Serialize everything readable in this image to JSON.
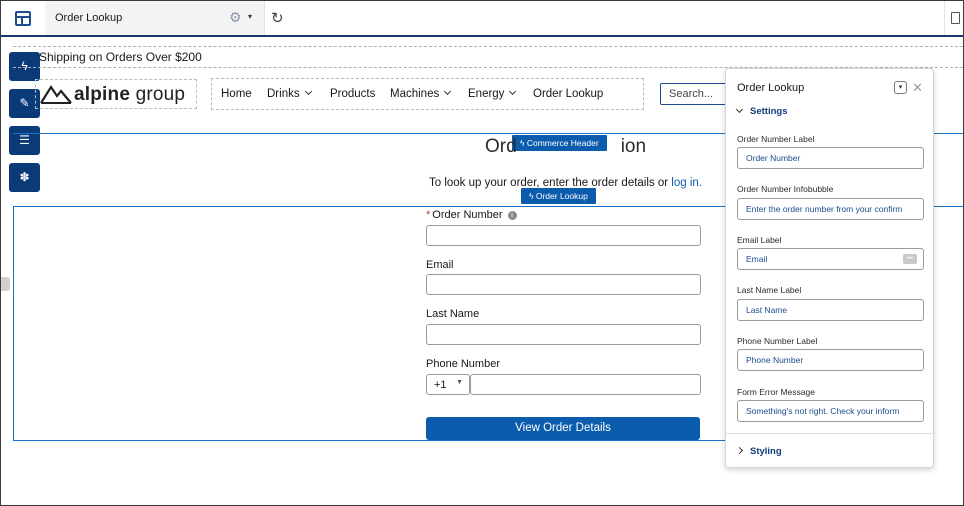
{
  "topbar": {
    "page_name": "Order Lookup",
    "gear_glyph": "⚙",
    "caret_glyph": "▾",
    "refresh_glyph": "↻"
  },
  "side_toolbar": [
    {
      "icon": "lightning-icon",
      "glyph": "ϟ"
    },
    {
      "icon": "brush-icon",
      "glyph": "✎"
    },
    {
      "icon": "list-icon",
      "glyph": "☰"
    },
    {
      "icon": "settings-icon",
      "glyph": "✽"
    }
  ],
  "store": {
    "promo": "Shipping on Orders Over $200",
    "logo_word1": "alpine",
    "logo_word2": "group",
    "nav": [
      {
        "label": "Home",
        "dropdown": false
      },
      {
        "label": "Drinks",
        "dropdown": true
      },
      {
        "label": "Products",
        "dropdown": false
      },
      {
        "label": "Machines",
        "dropdown": true
      },
      {
        "label": "Energy",
        "dropdown": true
      },
      {
        "label": "Order Lookup",
        "dropdown": false
      }
    ],
    "search_placeholder": "Search..."
  },
  "tags": {
    "commerce_header": "ϟ  Commerce Header",
    "order_lookup": "ϟ  Order Lookup"
  },
  "lookup": {
    "heading_left": "Ord",
    "heading_right": "ion",
    "intro": "To look up your order, enter the order details or ",
    "login_link": "log in.",
    "required_mark": "*",
    "order_number_label": "Order Number",
    "info_glyph": "i",
    "email_label": "Email",
    "last_name_label": "Last Name",
    "phone_label": "Phone Number",
    "country_code": "+1",
    "country_caret": "▼",
    "submit_label": "View Order Details"
  },
  "panel": {
    "title": "Order Lookup",
    "menu_glyph": "▾",
    "close_glyph": "✕",
    "settings_section": "Settings",
    "styling_section": "Styling",
    "fields": [
      {
        "label": "Order Number Label",
        "value": "Order Number"
      },
      {
        "label": "Order Number Infobubble",
        "value": "Enter the order number from your confirm"
      },
      {
        "label": "Email Label",
        "value": "Email"
      },
      {
        "label": "Last Name Label",
        "value": "Last Name"
      },
      {
        "label": "Phone Number Label",
        "value": "Phone Number"
      },
      {
        "label": "Form Error Message",
        "value": "Something's not right. Check your inform"
      }
    ],
    "email_field_icon": "•••"
  },
  "colors": {
    "brand_blue": "#0b5cad",
    "dark_navy": "#0b3a78",
    "selection_blue": "#1b74c8",
    "required_red": "#c23934"
  }
}
